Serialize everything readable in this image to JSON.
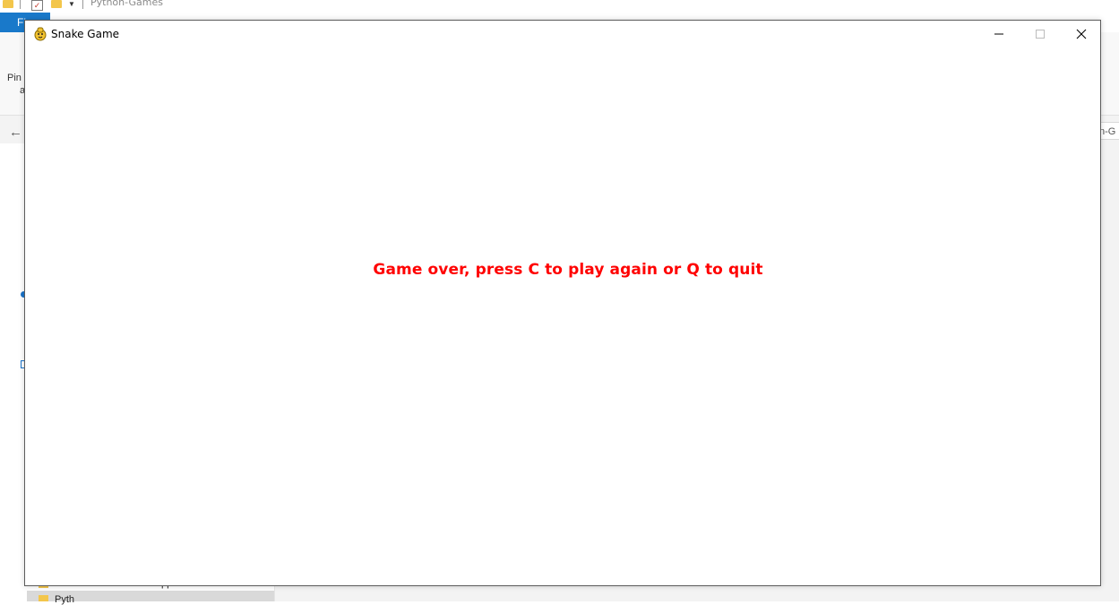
{
  "background_explorer": {
    "title": "Python-Games",
    "file_tab": "Fi",
    "pin_label": "Pin",
    "pin_label2": "a",
    "address_fragment": "n-G",
    "nav_item_text": "Pyth",
    "nav_item_text2": "pp",
    "colors": {
      "file_tab": "#1979ca",
      "folder": "#f3c64b",
      "accent": "#1a73c9"
    }
  },
  "game_window": {
    "title": "Snake Game",
    "icon": "pygame-snake-icon",
    "controls": {
      "minimize": "minimize-icon",
      "maximize": "maximize-icon",
      "close": "close-icon"
    },
    "message": "Game over, press C to play again or Q to quit",
    "message_color": "#ff0000",
    "background_color": "#ffffff"
  }
}
